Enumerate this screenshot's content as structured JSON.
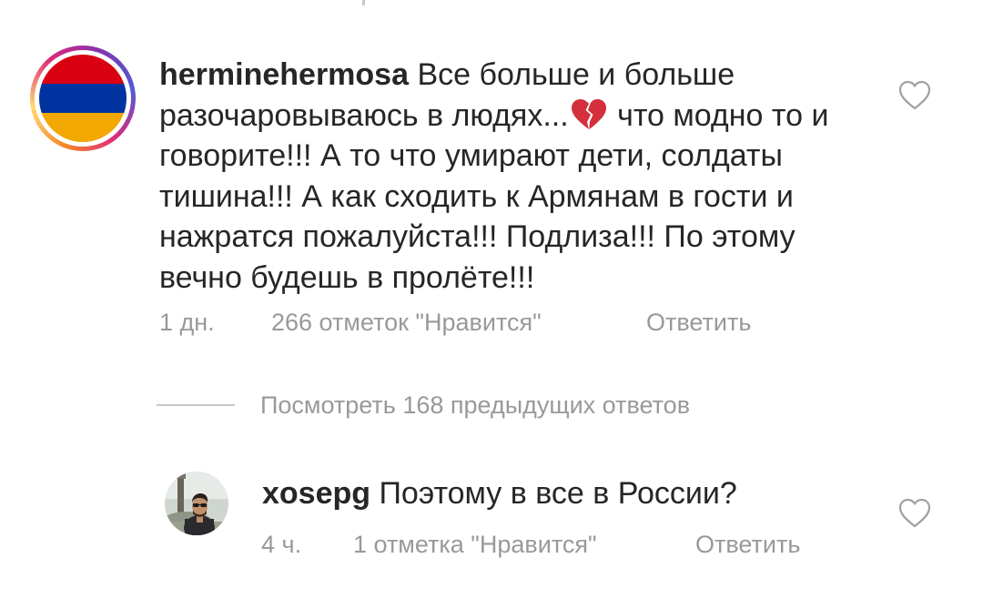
{
  "comment": {
    "username": "herminehermosa",
    "text_part1": " Все больше и больше разочаровываюсь в людях...",
    "emoji": "broken-heart",
    "text_part2": " что модно то и говорите!!! А то что умирают дети, солдаты тишина!!! А как сходить к Армянам в гости и нажратся пожалуйста!!! Подлиза!!! По этому вечно будешь в пролёте!!!",
    "time": "1 дн.",
    "likes": "266 отметок \"Нравится\"",
    "reply_label": "Ответить",
    "avatar_icon": "armenian-flag",
    "flag_colors": [
      "#d90012",
      "#0033a0",
      "#f2a800"
    ]
  },
  "view_replies": {
    "label": "Посмотреть 168 предыдущих ответов"
  },
  "reply": {
    "username": "xosepg",
    "text": " Поэтому в все в России?",
    "time": "4 ч.",
    "likes": "1 отметка \"Нравится\"",
    "reply_label": "Ответить",
    "avatar_icon": "user-photo"
  },
  "icons": {
    "like": "heart-outline-icon"
  },
  "colors": {
    "text": "#262626",
    "meta": "#999999",
    "divider": "#c7c7c7"
  }
}
